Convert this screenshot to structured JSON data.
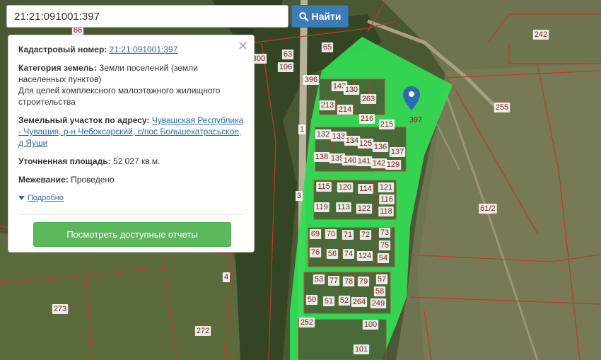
{
  "search": {
    "value": "21:21:091001:397",
    "button_label": "Найти",
    "button_icon": "search-icon"
  },
  "panel": {
    "cadastral_label": "Кадастровый номер:",
    "cadastral_value": "21:21:091001:397",
    "category_label": "Категория земель:",
    "category_value": "Земли поселений (земли населенных пунктов)",
    "category_purpose": "Для целей комплексного малоэтажного жилищного строительства",
    "address_label": "Земельный участок по адресу:",
    "address_value": "Чувашская Республика - Чувашия, р-н Чебоксарский, с/пос Большекатрасьское, д Яуши",
    "area_label": "Уточненная площадь:",
    "area_value": "52 027 кв.м.",
    "survey_label": "Межевание:",
    "survey_value": "Проведено",
    "details_label": "Подробно",
    "report_button": "Посмотреть доступные отчеты",
    "close_icon": "close-icon"
  },
  "map": {
    "highlight_color": "#33dd55",
    "boundary_color": "#c0392b",
    "selected_parcel": "397",
    "parcel_labels": [
      "66",
      "65",
      "63",
      "106",
      "300",
      "396",
      "143",
      "130",
      "263",
      "213",
      "214",
      "216",
      "215",
      "132",
      "133",
      "134",
      "125",
      "136",
      "137",
      "138",
      "139",
      "140",
      "141",
      "142",
      "129",
      "115",
      "120",
      "114",
      "121",
      "116",
      "119",
      "113",
      "122",
      "118",
      "69",
      "70",
      "71",
      "72",
      "73",
      "75",
      "76",
      "56",
      "74",
      "124",
      "54",
      "53",
      "77",
      "78",
      "79",
      "57",
      "58",
      "50",
      "51",
      "52",
      "264",
      "249",
      "252",
      "100",
      "101",
      "3",
      "1",
      "4",
      "273",
      "272",
      "242",
      "255",
      "61/2"
    ]
  }
}
